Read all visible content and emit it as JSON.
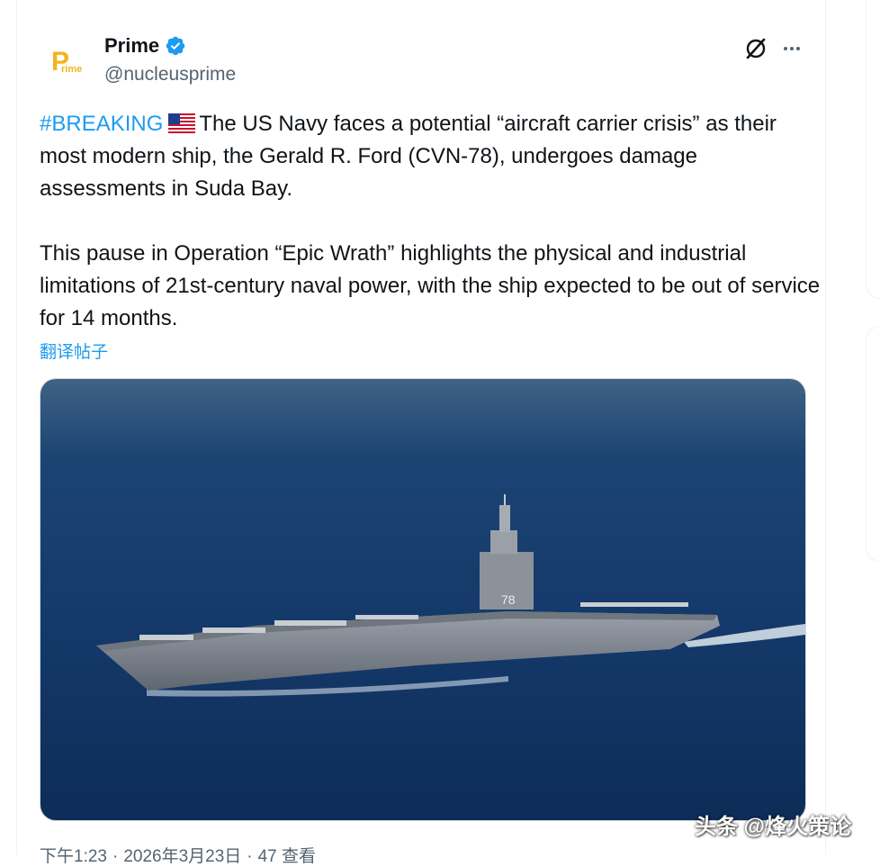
{
  "author": {
    "display_name": "Prime",
    "handle": "@nucleusprime",
    "verified": true,
    "avatar_icon": "prime-logo",
    "verified_color": "#1d9bf0"
  },
  "actions": {
    "grok_icon": "grok-icon",
    "more_icon": "more-horizontal-icon"
  },
  "tweet": {
    "hashtag": "#BREAKING",
    "flag_icon": "us-flag-emoji",
    "paragraph1": "The US Navy faces a potential “aircraft carrier crisis” as their most modern ship, the Gerald R. Ford (CVN-78), undergoes damage assessments in Suda Bay.",
    "paragraph2": "This pause in Operation “Epic Wrath” highlights the physical and industrial limitations of 21st-century naval power, with the ship expected to be out of service for 14 months.",
    "translate_label": "翻译帖子"
  },
  "media": {
    "subject": "aircraft-carrier-photo",
    "hull_marking": "78"
  },
  "meta": {
    "time": "下午1:23",
    "date": "2026年3月23日",
    "views_label": "查看",
    "views_count": "47"
  },
  "watermark": "头条 @烽火策论",
  "colors": {
    "link": "#1d9bf0",
    "text": "#0f1419",
    "secondary": "#536471",
    "border": "#eff3f4"
  }
}
